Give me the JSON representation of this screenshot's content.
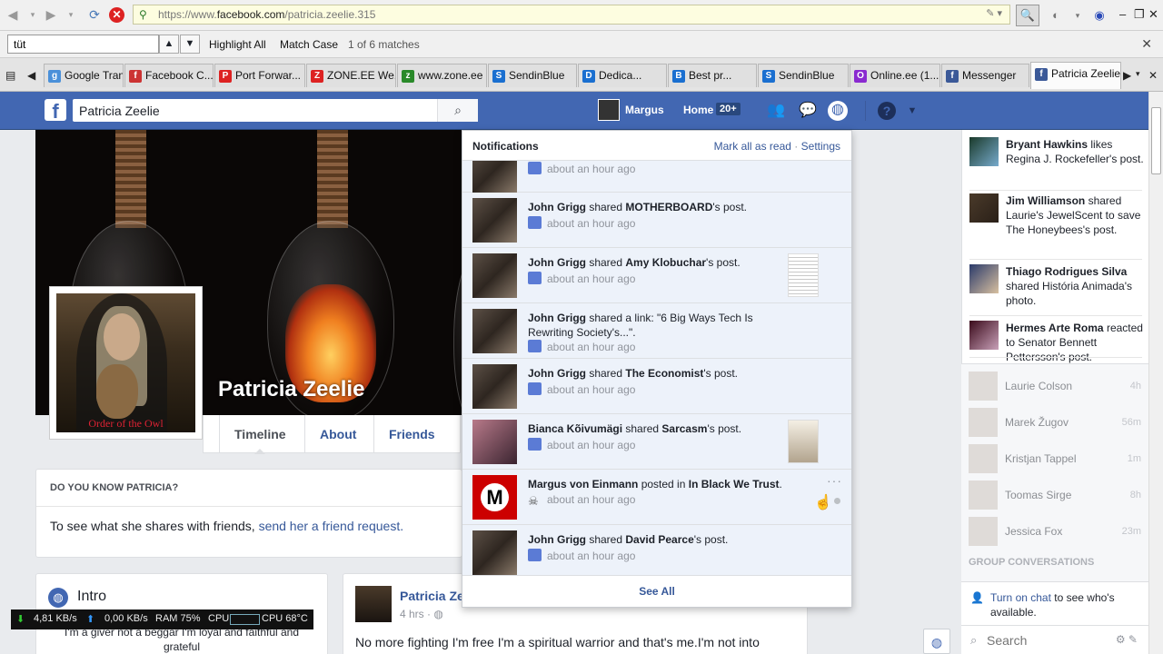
{
  "browser": {
    "url_prefix": "https://www.",
    "url_domain": "facebook.com",
    "url_path": "/patricia.zeelie.315",
    "find": {
      "query": "tüt",
      "highlight_all": "Highlight All",
      "match_case": "Match Case",
      "matches": "1 of 6 matches"
    },
    "tabs": [
      {
        "label": "Google Tran...",
        "color": "#4a90d9",
        "glyph": "g"
      },
      {
        "label": "Facebook C...",
        "color": "#c33",
        "glyph": "f"
      },
      {
        "label": "Port Forwar...",
        "color": "#d22",
        "glyph": "P"
      },
      {
        "label": "ZONE.EE We...",
        "color": "#d22",
        "glyph": "Z"
      },
      {
        "label": "www.zone.ee",
        "color": "#2a8a2a",
        "glyph": "z"
      },
      {
        "label": "SendinBlue",
        "color": "#1a6fd0",
        "glyph": "S"
      },
      {
        "label": "Dedica...",
        "color": "#1a6fd0",
        "glyph": "D"
      },
      {
        "label": "Best pr...",
        "color": "#1a6fd0",
        "glyph": "B"
      },
      {
        "label": "SendinBlue",
        "color": "#1a6fd0",
        "glyph": "S"
      },
      {
        "label": "Online.ee (1...",
        "color": "#8a2ad0",
        "glyph": "O"
      },
      {
        "label": "Messenger",
        "color": "#3b5998",
        "glyph": "f"
      },
      {
        "label": "Patricia Zeelie",
        "color": "#3b5998",
        "glyph": "f"
      }
    ]
  },
  "fb": {
    "search_value": "Patricia Zeelie",
    "user_name": "Margus",
    "home_label": "Home",
    "home_badge": "20+",
    "brand_color": "#4267b2"
  },
  "profile": {
    "name": "Patricia Zeelie",
    "picture_caption": "Order of the Owl",
    "nav": {
      "timeline": "Timeline",
      "about": "About",
      "friends": "Friends"
    },
    "know_title": "DO YOU KNOW PATRICIA?",
    "know_text": "To see what she shares with friends, ",
    "know_link": "send her a friend request.",
    "intro_title": "Intro",
    "intro_text": "I'm a giver not a beggar I'm loyal and faithful and grateful",
    "post": {
      "author": "Patricia Ze",
      "time": "4 hrs · ",
      "text": "No more fighting I'm free I'm a spiritual warrior and that's me.I'm not into"
    }
  },
  "notifications": {
    "title": "Notifications",
    "mark_all": "Mark all as read",
    "settings": "Settings",
    "see_all": "See All",
    "items": [
      {
        "parts": [],
        "time": "about an hour ago"
      },
      {
        "parts": [
          {
            "b": "John Grigg"
          },
          {
            "t": " shared "
          },
          {
            "b": "MOTHERBOARD"
          },
          {
            "t": "'s post."
          }
        ],
        "time": "about an hour ago"
      },
      {
        "parts": [
          {
            "b": "John Grigg"
          },
          {
            "t": " shared "
          },
          {
            "b": "Amy Klobuchar"
          },
          {
            "t": "'s post."
          }
        ],
        "time": "about an hour ago"
      },
      {
        "parts": [
          {
            "b": "John Grigg"
          },
          {
            "t": " shared a link: \"6 Big Ways Tech Is Rewriting Society's...\"."
          }
        ],
        "time": "about an hour ago"
      },
      {
        "parts": [
          {
            "b": "John Grigg"
          },
          {
            "t": " shared "
          },
          {
            "b": "The Economist"
          },
          {
            "t": "'s post."
          }
        ],
        "time": "about an hour ago"
      },
      {
        "parts": [
          {
            "b": "Bianca Kõivumägi"
          },
          {
            "t": " shared "
          },
          {
            "b": "Sarcasm"
          },
          {
            "t": "'s post."
          }
        ],
        "time": "about an hour ago"
      },
      {
        "parts": [
          {
            "b": "Margus von Einmann"
          },
          {
            "t": " posted in "
          },
          {
            "b": "In Black We Trust"
          },
          {
            "t": "."
          }
        ],
        "time": "about an hour ago",
        "more": "···"
      },
      {
        "parts": [
          {
            "b": "John Grigg"
          },
          {
            "t": " shared "
          },
          {
            "b": "David Pearce"
          },
          {
            "t": "'s post."
          }
        ],
        "time": "about an hour ago"
      }
    ]
  },
  "ticker": [
    {
      "parts": [
        {
          "b": "Bryant Hawkins"
        },
        {
          "t": " likes Regina J. Rockefeller's post."
        }
      ]
    },
    {
      "parts": [
        {
          "b": "Jim Williamson"
        },
        {
          "t": " shared Laurie's JewelScent to save The Honeybees's post."
        }
      ]
    },
    {
      "parts": [
        {
          "b": "Thiago Rodrigues Silva"
        },
        {
          "t": " shared História Animada's photo."
        }
      ]
    },
    {
      "parts": [
        {
          "b": "Hermes Arte Roma"
        },
        {
          "t": " reacted to Senator Bennett Pettersson's post."
        }
      ]
    }
  ],
  "chat": {
    "contacts": [
      {
        "name": "Laurie Colson",
        "time": "4h"
      },
      {
        "name": "Marek Žugov",
        "time": "56m"
      },
      {
        "name": "Kristjan Tappel",
        "time": "1m"
      },
      {
        "name": "Toomas Sirge",
        "time": "8h"
      },
      {
        "name": "Jessica Fox",
        "time": "23m"
      }
    ],
    "group_title": "GROUP CONVERSATIONS",
    "turn_on_link": "Turn on chat",
    "turn_on_rest": " to see who's available.",
    "search_placeholder": "Search"
  },
  "sysmon": {
    "down": "4,81 KB/s",
    "up": "0,00 KB/s",
    "ram": "RAM 75%",
    "cpu_label": "CPU",
    "cpu_temp": "CPU 68°C"
  }
}
